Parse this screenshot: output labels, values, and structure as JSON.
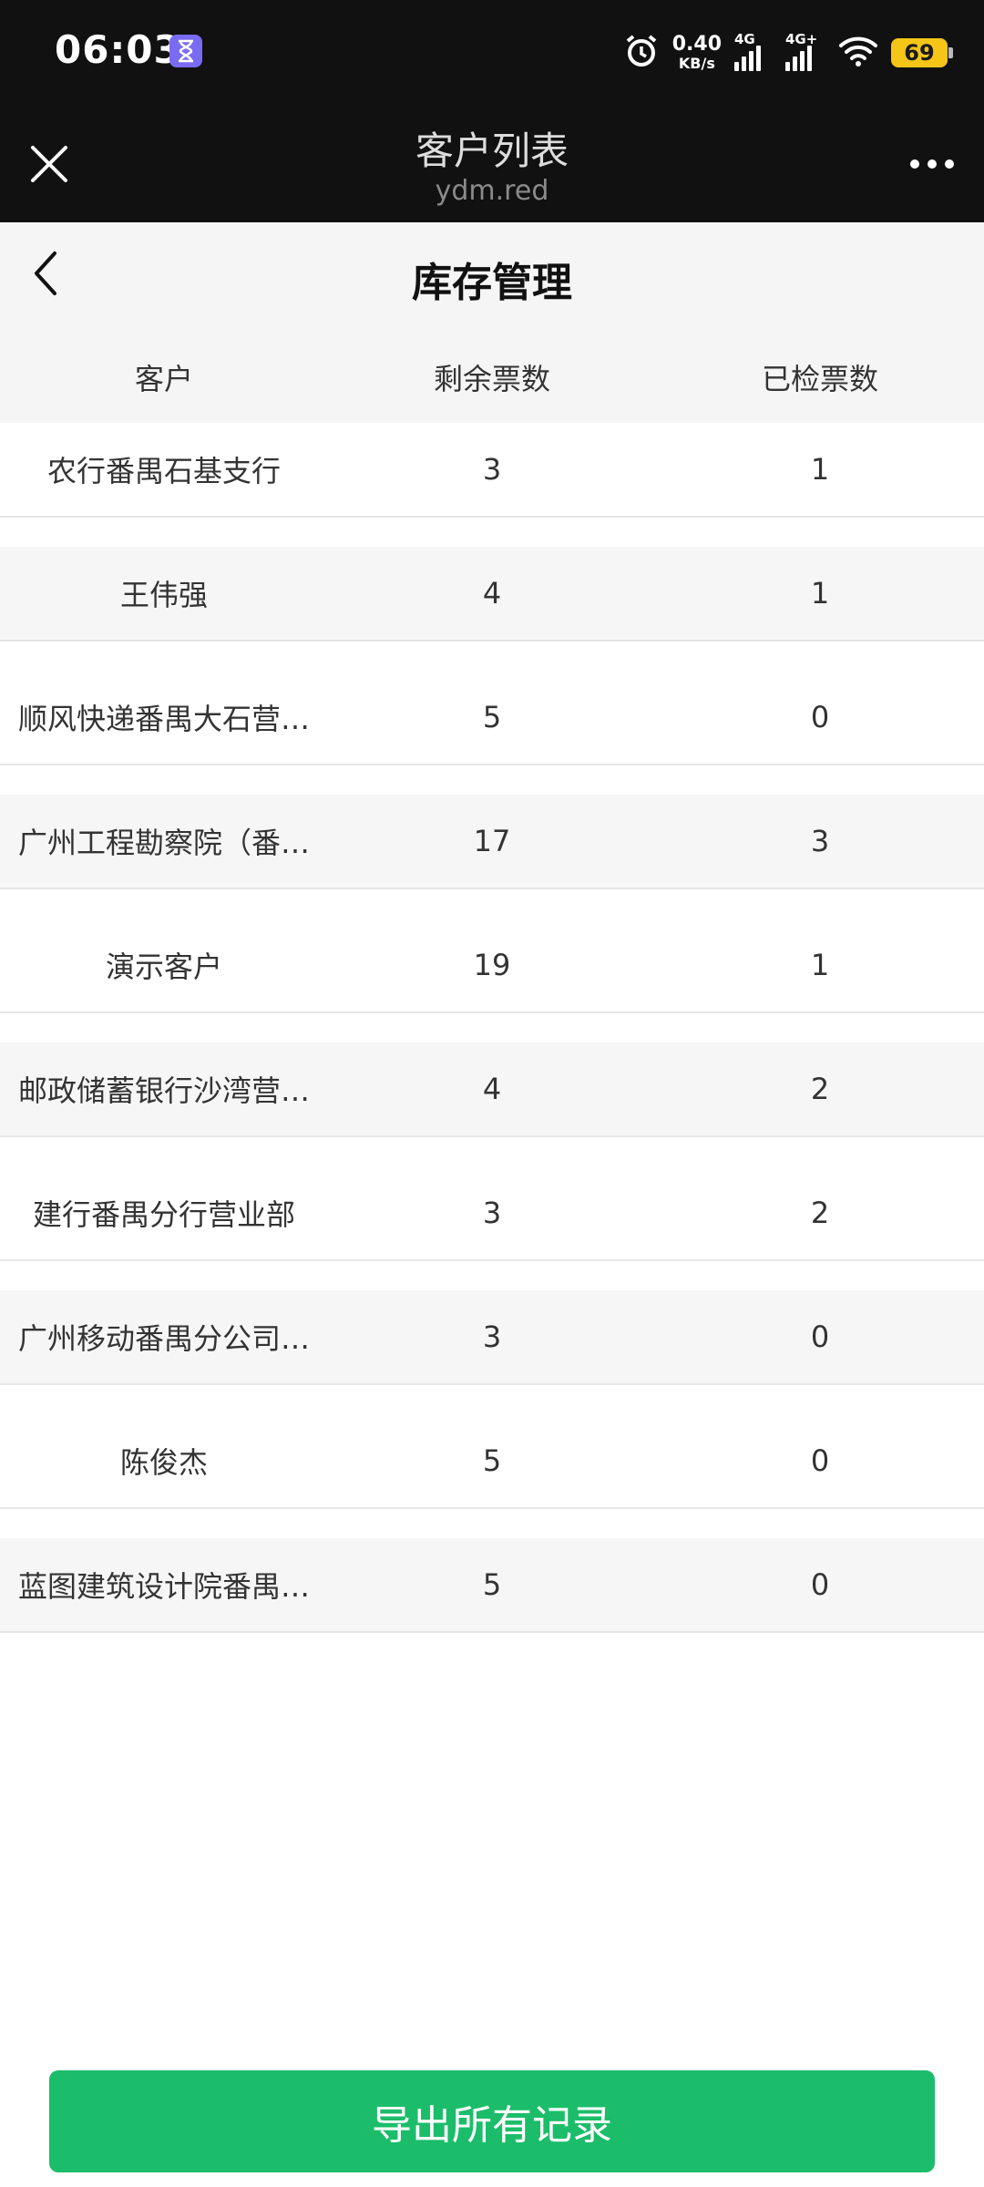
{
  "status_bar": {
    "time": "06:03",
    "net_speed_value": "0.40",
    "net_speed_unit": "KB/s",
    "signal1_label": "4G",
    "signal2_label": "4G+",
    "battery_level": "69",
    "icons": [
      "hourglass-icon",
      "alarm-icon",
      "signal-icon",
      "wifi-icon",
      "battery-icon"
    ]
  },
  "browser": {
    "title": "客户列表",
    "domain": "ydm.red"
  },
  "page": {
    "title": "库存管理"
  },
  "table": {
    "headers": {
      "customer": "客户",
      "remaining": "剩余票数",
      "checked": "已检票数"
    },
    "rows": [
      {
        "customer": "农行番禺石基支行",
        "remaining": "3",
        "checked": "1"
      },
      {
        "customer": "王伟强",
        "remaining": "4",
        "checked": "1"
      },
      {
        "customer": "顺风快递番禺大石营…",
        "remaining": "5",
        "checked": "0"
      },
      {
        "customer": "广州工程勘察院（番…",
        "remaining": "17",
        "checked": "3"
      },
      {
        "customer": "演示客户",
        "remaining": "19",
        "checked": "1"
      },
      {
        "customer": "邮政储蓄银行沙湾营…",
        "remaining": "4",
        "checked": "2"
      },
      {
        "customer": "建行番禺分行营业部",
        "remaining": "3",
        "checked": "2"
      },
      {
        "customer": "广州移动番禺分公司…",
        "remaining": "3",
        "checked": "0"
      },
      {
        "customer": "陈俊杰",
        "remaining": "5",
        "checked": "0"
      },
      {
        "customer": "蓝图建筑设计院番禺…",
        "remaining": "5",
        "checked": "0"
      }
    ]
  },
  "actions": {
    "export_label": "导出所有记录"
  },
  "colors": {
    "status_bg": "#111111",
    "accent_green": "#1cbd6a",
    "battery": "#f5c518"
  }
}
